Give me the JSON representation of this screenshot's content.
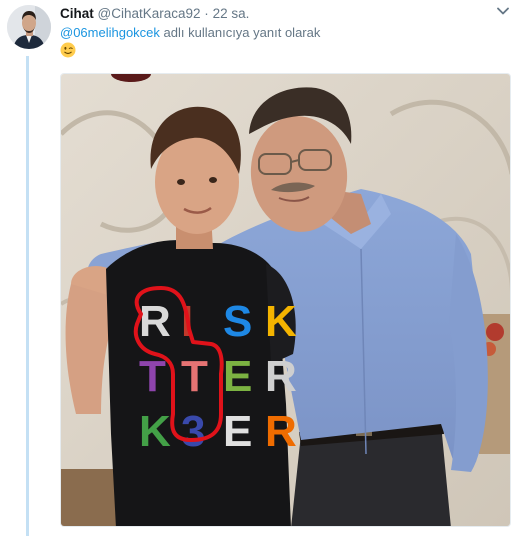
{
  "tweet": {
    "author_name": "Cihat",
    "author_handle": "@CihatKaraca92",
    "separator": "·",
    "timestamp": "22 sa.",
    "reply_mention": "@06melihgokcek",
    "reply_suffix": "adlı kullanıcıya yanıt olarak",
    "body_emoji": "winking-face",
    "photo_shirt_text": {
      "row1": [
        "R",
        "I",
        "S",
        "K"
      ],
      "row2": [
        "T",
        "T",
        "E",
        "R"
      ],
      "row3": [
        "K",
        "3",
        "E",
        "R"
      ]
    }
  },
  "colors": {
    "link": "#1b95e0",
    "thread_line": "#c4e0f4",
    "muted": "#657786",
    "annotation": "#e0121a"
  }
}
